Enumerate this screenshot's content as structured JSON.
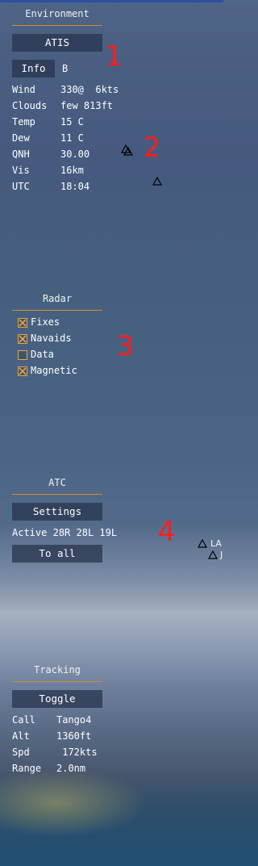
{
  "colors": {
    "accent_rule": "#d58b2b",
    "checkbox_border": "#e7a444",
    "annotation": "#ff1d1d",
    "button_bg": "#28344e"
  },
  "environment": {
    "title": "Environment",
    "atis_button": "ATIS",
    "info_button": "Info",
    "info_code": "B",
    "rows": [
      {
        "label": "Wind",
        "value": "330@  6kts"
      },
      {
        "label": "Clouds",
        "value": "few 813ft"
      },
      {
        "label": "Temp",
        "value": "15 C"
      },
      {
        "label": "Dew",
        "value": "11 C"
      },
      {
        "label": "QNH",
        "value": "30.00"
      },
      {
        "label": "Vis",
        "value": "16km"
      },
      {
        "label": "UTC",
        "value": "18:04"
      }
    ]
  },
  "radar": {
    "title": "Radar",
    "options": [
      {
        "label": "Fixes",
        "checked": true
      },
      {
        "label": "Navaids",
        "checked": true
      },
      {
        "label": "Data",
        "checked": false
      },
      {
        "label": "Magnetic",
        "checked": true
      }
    ]
  },
  "atc": {
    "title": "ATC",
    "settings_button": "Settings",
    "active_label": "Active",
    "active_runways": "28R 28L 19L",
    "to_all_button": "To all"
  },
  "tracking": {
    "title": "Tracking",
    "toggle_button": "Toggle",
    "rows": [
      {
        "label": "Call",
        "value": "Tango4"
      },
      {
        "label": "Alt",
        "value": "1360ft"
      },
      {
        "label": "Spd",
        "value": " 172kts"
      },
      {
        "label": "Range",
        "value": "2.0nm"
      }
    ]
  },
  "annotations": [
    "1",
    "2",
    "3",
    "4"
  ],
  "map_labels": {
    "fix_la": "LA",
    "fix_j": "J"
  }
}
